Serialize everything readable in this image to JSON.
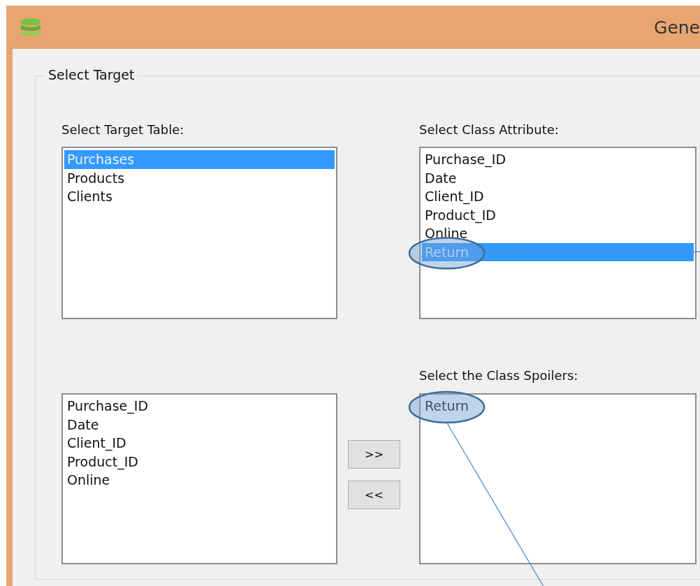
{
  "window": {
    "title": "Gene"
  },
  "group": {
    "title": "Select Target",
    "lists": [
      {
        "label": "Select Target Table:",
        "items": [
          {
            "text": "Purchases",
            "selected": true,
            "circled": false
          },
          {
            "text": "Products",
            "selected": false,
            "circled": false
          },
          {
            "text": "Clients",
            "selected": false,
            "circled": false
          }
        ]
      },
      {
        "label": "Select Class Attribute:",
        "items": [
          {
            "text": "Purchase_ID",
            "selected": false,
            "circled": false
          },
          {
            "text": "Date",
            "selected": false,
            "circled": false
          },
          {
            "text": "Client_ID",
            "selected": false,
            "circled": false
          },
          {
            "text": "Product_ID",
            "selected": false,
            "circled": false
          },
          {
            "text": "Online",
            "selected": false,
            "circled": false
          },
          {
            "text": "Return",
            "selected": true,
            "circled": true
          }
        ]
      },
      {
        "label": "Select the Class Spoilers:",
        "items": [
          {
            "text": "Return",
            "selected": false,
            "circled": true
          }
        ]
      }
    ],
    "field_list": {
      "items": [
        {
          "text": "Purchase_ID",
          "selected": false
        },
        {
          "text": "Date",
          "selected": false
        },
        {
          "text": "Client_ID",
          "selected": false
        },
        {
          "text": "Product_ID",
          "selected": false
        },
        {
          "text": "Online",
          "selected": false
        }
      ]
    },
    "buttons": [
      ">>",
      "<<"
    ]
  }
}
